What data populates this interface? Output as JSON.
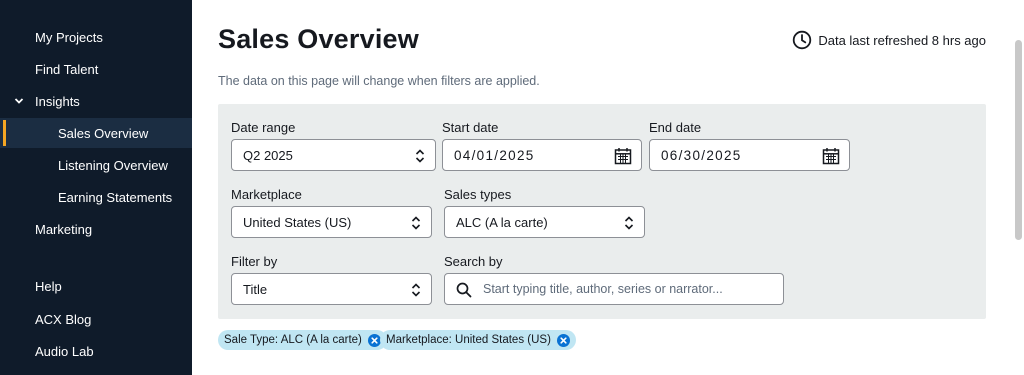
{
  "sidebar": {
    "items": [
      {
        "label": "My Projects"
      },
      {
        "label": "Find Talent"
      },
      {
        "label": "Insights"
      },
      {
        "label": "Sales Overview"
      },
      {
        "label": "Listening Overview"
      },
      {
        "label": "Earning Statements"
      },
      {
        "label": "Marketing"
      },
      {
        "label": "Help"
      },
      {
        "label": "ACX Blog"
      },
      {
        "label": "Audio Lab"
      }
    ],
    "accent_color": "#f5a623"
  },
  "header": {
    "title": "Sales Overview",
    "refresh_text": "Data last refreshed 8 hrs ago",
    "subtitle": "The data on this page will change when filters are applied."
  },
  "filters": {
    "date_range": {
      "label": "Date range",
      "value": "Q2 2025"
    },
    "start_date": {
      "label": "Start date",
      "value": "04/01/2025"
    },
    "end_date": {
      "label": "End date",
      "value": "06/30/2025"
    },
    "marketplace": {
      "label": "Marketplace",
      "value": "United States (US)"
    },
    "sales_types": {
      "label": "Sales types",
      "value": "ALC (A la carte)"
    },
    "filter_by": {
      "label": "Filter by",
      "value": "Title"
    },
    "search_by": {
      "label": "Search by",
      "placeholder": "Start typing title, author, series or narrator..."
    }
  },
  "chips": [
    {
      "label": "Sale Type: ALC (A la carte)"
    },
    {
      "label": "Marketplace: United States (US)"
    }
  ],
  "icons": {
    "refresh": "clock-icon",
    "calendar": "calendar-icon",
    "search": "search-icon",
    "remove": "close-circle-icon",
    "select": "updown-chevron-icon"
  }
}
